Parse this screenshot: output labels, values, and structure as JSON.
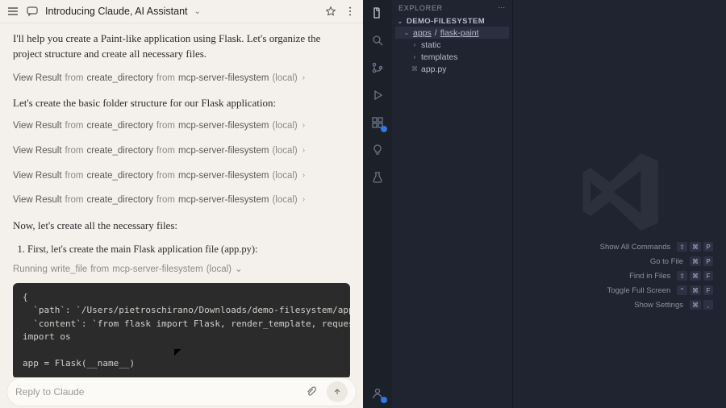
{
  "header": {
    "title": "Introducing Claude, AI Assistant"
  },
  "conversation": {
    "intro": "I'll help you create a Paint-like application using Flask. Let's organize the project structure and create all necessary files.",
    "folder_line": "Let's create the basic folder structure for our Flask application:",
    "result_label_prefix": "View Result",
    "result_from": "from",
    "result_tool": "create_directory",
    "result_server": "mcp-server-filesystem",
    "result_scope": "(local)",
    "necessary_line": "Now, let's create all the necessary files:",
    "ol_item_1": "First, let's create the main Flask application file (app.py):",
    "running_prefix": "Running",
    "running_tool": "write_file",
    "running_from": "from",
    "running_server": "mcp-server-filesystem",
    "running_scope": "(local)",
    "code": "{\n  `path`: `/Users/pietroschirano/Downloads/demo-filesystem/apps/flask-paint/a\n  `content`: `from flask import Flask, render_template, request, jsonify\nimport os\n\napp = Flask(__name__)"
  },
  "reply": {
    "placeholder": "Reply to Claude"
  },
  "explorer": {
    "title": "EXPLORER",
    "root": "DEMO-FILESYSTEM",
    "tree": {
      "apps": "apps",
      "flask_paint": "flask-paint",
      "static": "static",
      "templates": "templates",
      "app_py": "app.py"
    }
  },
  "shortcuts": {
    "show_all": "Show All Commands",
    "go_to_file": "Go to File",
    "find_in_files": "Find in Files",
    "toggle_full": "Toggle Full Screen",
    "show_settings": "Show Settings",
    "keys": {
      "shift": "⇧",
      "cmd": "⌘",
      "ctrl": "⌃",
      "p": "P",
      "f": "F",
      "comma": ","
    }
  }
}
